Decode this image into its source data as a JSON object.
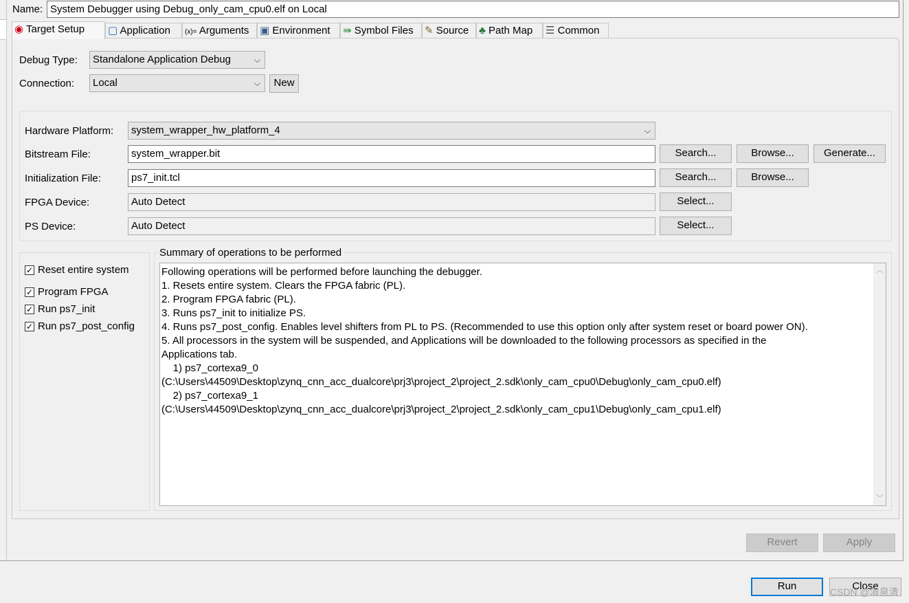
{
  "name_label": "Name:",
  "name_value": "System Debugger using Debug_only_cam_cpu0.elf on Local",
  "tabs": [
    {
      "label": "Target Setup",
      "icon": "target-icon",
      "active": true
    },
    {
      "label": "Application",
      "icon": "application-icon"
    },
    {
      "label": "Arguments",
      "icon": "arguments-icon",
      "icon_text": "(x)="
    },
    {
      "label": "Environment",
      "icon": "environment-icon"
    },
    {
      "label": "Symbol Files",
      "icon": "symbol-files-icon"
    },
    {
      "label": "Source",
      "icon": "source-icon"
    },
    {
      "label": "Path Map",
      "icon": "path-map-icon"
    },
    {
      "label": "Common",
      "icon": "common-icon"
    }
  ],
  "debug_type": {
    "label": "Debug Type:",
    "value": "Standalone Application Debug"
  },
  "connection": {
    "label": "Connection:",
    "value": "Local",
    "new_label": "New"
  },
  "hardware": {
    "platform_label": "Hardware Platform:",
    "platform_value": "system_wrapper_hw_platform_4",
    "bitstream_label": "Bitstream File:",
    "bitstream_value": "system_wrapper.bit",
    "init_label": "Initialization File:",
    "init_value": "ps7_init.tcl",
    "fpga_label": "FPGA Device:",
    "fpga_value": "Auto Detect",
    "ps_label": "PS Device:",
    "ps_value": "Auto Detect",
    "search": "Search...",
    "browse": "Browse...",
    "generate": "Generate...",
    "select": "Select..."
  },
  "options": [
    {
      "label": "Reset entire system",
      "checked": true
    },
    {
      "label": "Program FPGA",
      "checked": true
    },
    {
      "label": "Run ps7_init",
      "checked": true
    },
    {
      "label": "Run ps7_post_config",
      "checked": true
    }
  ],
  "summary": {
    "title": "Summary of operations to be performed",
    "text": "Following operations will be performed before launching the debugger.\n1. Resets entire system. Clears the FPGA fabric (PL).\n2. Program FPGA fabric (PL).\n3. Runs ps7_init to initialize PS.\n4. Runs ps7_post_config. Enables level shifters from PL to PS. (Recommended to use this option only after system reset or board power ON).\n5. All processors in the system will be suspended, and Applications will be downloaded to the following processors as specified in the\nApplications tab.\n    1) ps7_cortexa9_0\n(C:\\Users\\44509\\Desktop\\zynq_cnn_acc_dualcore\\prj3\\project_2\\project_2.sdk\\only_cam_cpu0\\Debug\\only_cam_cpu0.elf)\n    2) ps7_cortexa9_1\n(C:\\Users\\44509\\Desktop\\zynq_cnn_acc_dualcore\\prj3\\project_2\\project_2.sdk\\only_cam_cpu1\\Debug\\only_cam_cpu1.elf)"
  },
  "buttons": {
    "revert": "Revert",
    "apply": "Apply",
    "run": "Run",
    "close": "Close"
  },
  "watermark": "CSDN @清泉清",
  "colors": {
    "accent": "#0078d7",
    "target_icon": "#d0021b"
  }
}
